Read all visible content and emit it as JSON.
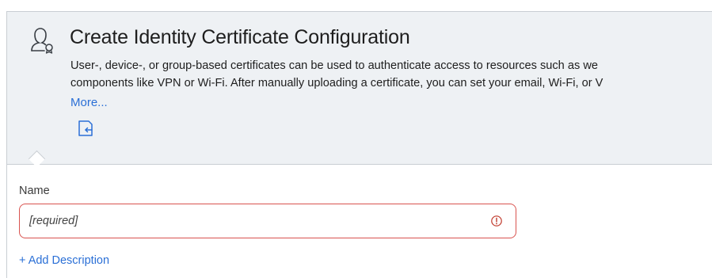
{
  "header": {
    "title": "Create Identity Certificate Configuration",
    "description_line1": "User-, device-, or group-based certificates can be used to authenticate access to resources such as we",
    "description_line2": "components like VPN or Wi-Fi.  After manually uploading a certificate, you can set your email, Wi-Fi, or V",
    "more_label": "More...",
    "icon": "certificate-person-icon",
    "import_icon": "import-icon"
  },
  "form": {
    "name_label": "Name",
    "name_placeholder": "[required]",
    "name_value": "",
    "alert_icon": "alert-circle-icon",
    "add_description_label": "+ Add Description"
  },
  "colors": {
    "accent": "#2a6fd6",
    "error_border": "#d9534f",
    "header_bg": "#eef1f4"
  }
}
